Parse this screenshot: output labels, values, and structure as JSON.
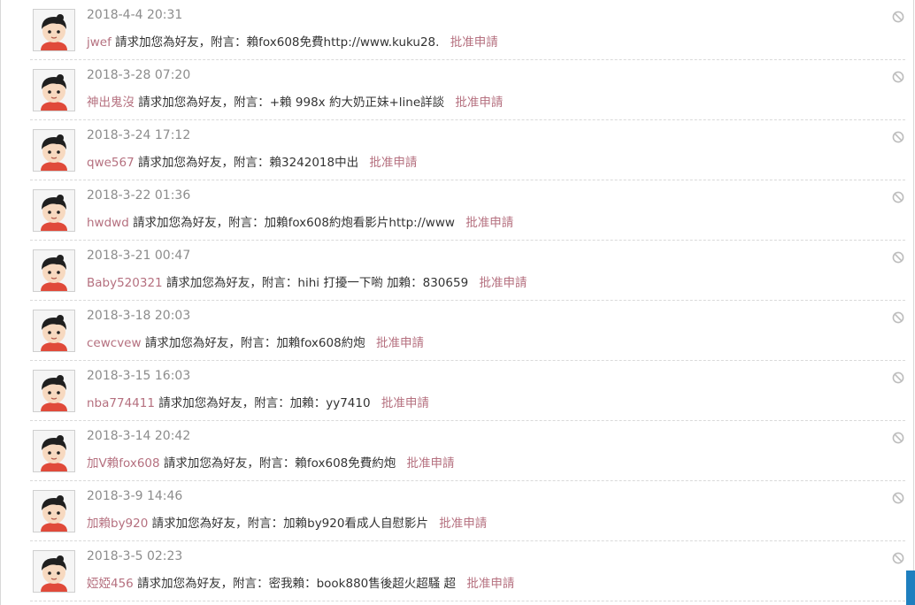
{
  "requests": [
    {
      "time": "2018-4-4 20:31",
      "user": "jwef",
      "text": "請求加您為好友，附言：賴fox608免費http://www.kuku28.",
      "action": "批准申請"
    },
    {
      "time": "2018-3-28 07:20",
      "user": "神出鬼沒",
      "text": "請求加您為好友，附言：+賴 998x 約大奶正妹+line詳談",
      "action": "批准申請"
    },
    {
      "time": "2018-3-24 17:12",
      "user": "qwe567",
      "text": "請求加您為好友，附言：賴3242018中出",
      "action": "批准申請"
    },
    {
      "time": "2018-3-22 01:36",
      "user": "hwdwd",
      "text": "請求加您為好友，附言：加賴fox608約炮看影片http://www",
      "action": "批准申請"
    },
    {
      "time": "2018-3-21 00:47",
      "user": "Baby520321",
      "text": "請求加您為好友，附言：hihi 打擾一下喲 加賴：830659",
      "action": "批准申請"
    },
    {
      "time": "2018-3-18 20:03",
      "user": "cewcvew",
      "text": "請求加您為好友，附言：加賴fox608約炮",
      "action": "批准申請"
    },
    {
      "time": "2018-3-15 16:03",
      "user": "nba774411",
      "text": "請求加您為好友，附言：加賴：yy7410",
      "action": "批准申請"
    },
    {
      "time": "2018-3-14 20:42",
      "user": "加V賴fox608",
      "text": "請求加您為好友，附言：賴fox608免費約炮",
      "action": "批准申請"
    },
    {
      "time": "2018-3-9 14:46",
      "user": "加賴by920",
      "text": "請求加您為好友，附言：加賴by920看成人自慰影片",
      "action": "批准申請"
    },
    {
      "time": "2018-3-5 02:23",
      "user": "婭婭456",
      "text": "請求加您為好友，附言：密我賴：book880售後超火超騷 超",
      "action": "批准申請"
    }
  ],
  "icons": {
    "avatar": "default-avatar-icon",
    "ignore": "ignore-icon"
  },
  "colors": {
    "link": "#b5707f",
    "time": "#8c8c8c",
    "text": "#333333",
    "scrollbar": "#1e7fbf"
  }
}
